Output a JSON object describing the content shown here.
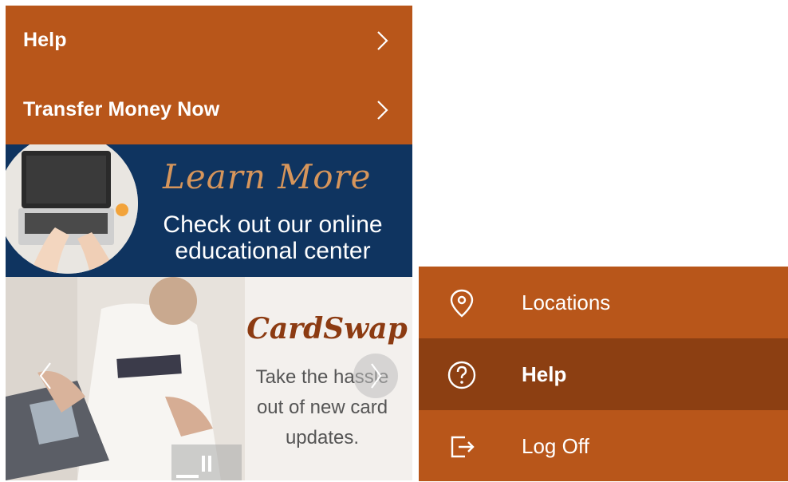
{
  "left_menu": {
    "items": [
      {
        "label": "Help"
      },
      {
        "label": "Transfer Money Now"
      }
    ]
  },
  "banner_learn": {
    "title": "Learn More",
    "line1": "Check out our online",
    "line2": "educational center"
  },
  "banner_card": {
    "title": "CardSwap",
    "line1": "Take the hassle",
    "line2": "out of new card",
    "line3": "updates."
  },
  "right_menu": {
    "items": [
      {
        "label": "Locations",
        "icon": "map-pin-icon"
      },
      {
        "label": "Help",
        "icon": "question-circle-icon",
        "active": true
      },
      {
        "label": "Log Off",
        "icon": "log-off-icon"
      }
    ]
  },
  "colors": {
    "brand": "#b8561a",
    "brand_active": "#8c3f12",
    "navy": "#0f3460",
    "accent_copper": "#d6955b"
  }
}
